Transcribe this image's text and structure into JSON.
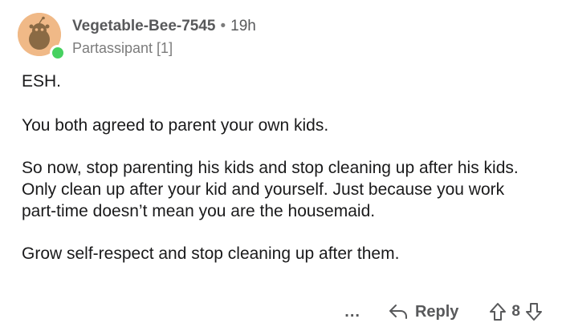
{
  "comment": {
    "author": "Vegetable-Bee-7545",
    "separator": "•",
    "time": "19h",
    "flair": "Partassipant [1]",
    "paragraphs": [
      "ESH.",
      "You both agreed to parent your own kids.",
      "So now, stop parenting his kids and stop cleaning up after his kids. Only clean up after your kid and yourself. Just because you work part-time doesn’t mean you are the housemaid.",
      "Grow self-respect and stop cleaning up after them."
    ]
  },
  "actions": {
    "more": "...",
    "reply_label": "Reply",
    "score": "8"
  },
  "colors": {
    "avatar_bg": "#f0b987",
    "online": "#46d160",
    "text": "#1a1a1b",
    "meta": "#58595b"
  },
  "icons": [
    "snoo-avatar-icon",
    "reply-arrow-icon",
    "upvote-icon",
    "downvote-icon"
  ]
}
